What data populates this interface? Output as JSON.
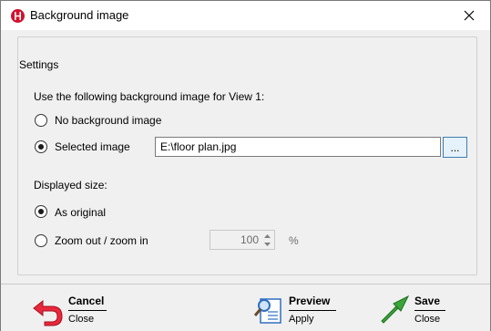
{
  "window": {
    "title": "Background image"
  },
  "settings": {
    "group_label": "Settings",
    "intro": "Use the following background image for View 1:",
    "option_none": "No background image",
    "option_selected": "Selected image",
    "image_path": "E:\\floor plan.jpg",
    "browse_label": "...",
    "displayed_size_label": "Displayed size:",
    "option_original": "As original",
    "option_zoom": "Zoom out / zoom in",
    "zoom_value": "100",
    "zoom_unit": "%"
  },
  "footer": {
    "cancel": {
      "label": "Cancel",
      "sub": "Close"
    },
    "preview": {
      "label": "Preview",
      "sub": "Apply"
    },
    "save": {
      "label": "Save",
      "sub": "Close"
    }
  },
  "colors": {
    "app_icon_red": "#d2122e",
    "cancel_arrow": "#e8283c",
    "save_arrow": "#3aa63a",
    "preview_blue": "#2f6fc0"
  }
}
